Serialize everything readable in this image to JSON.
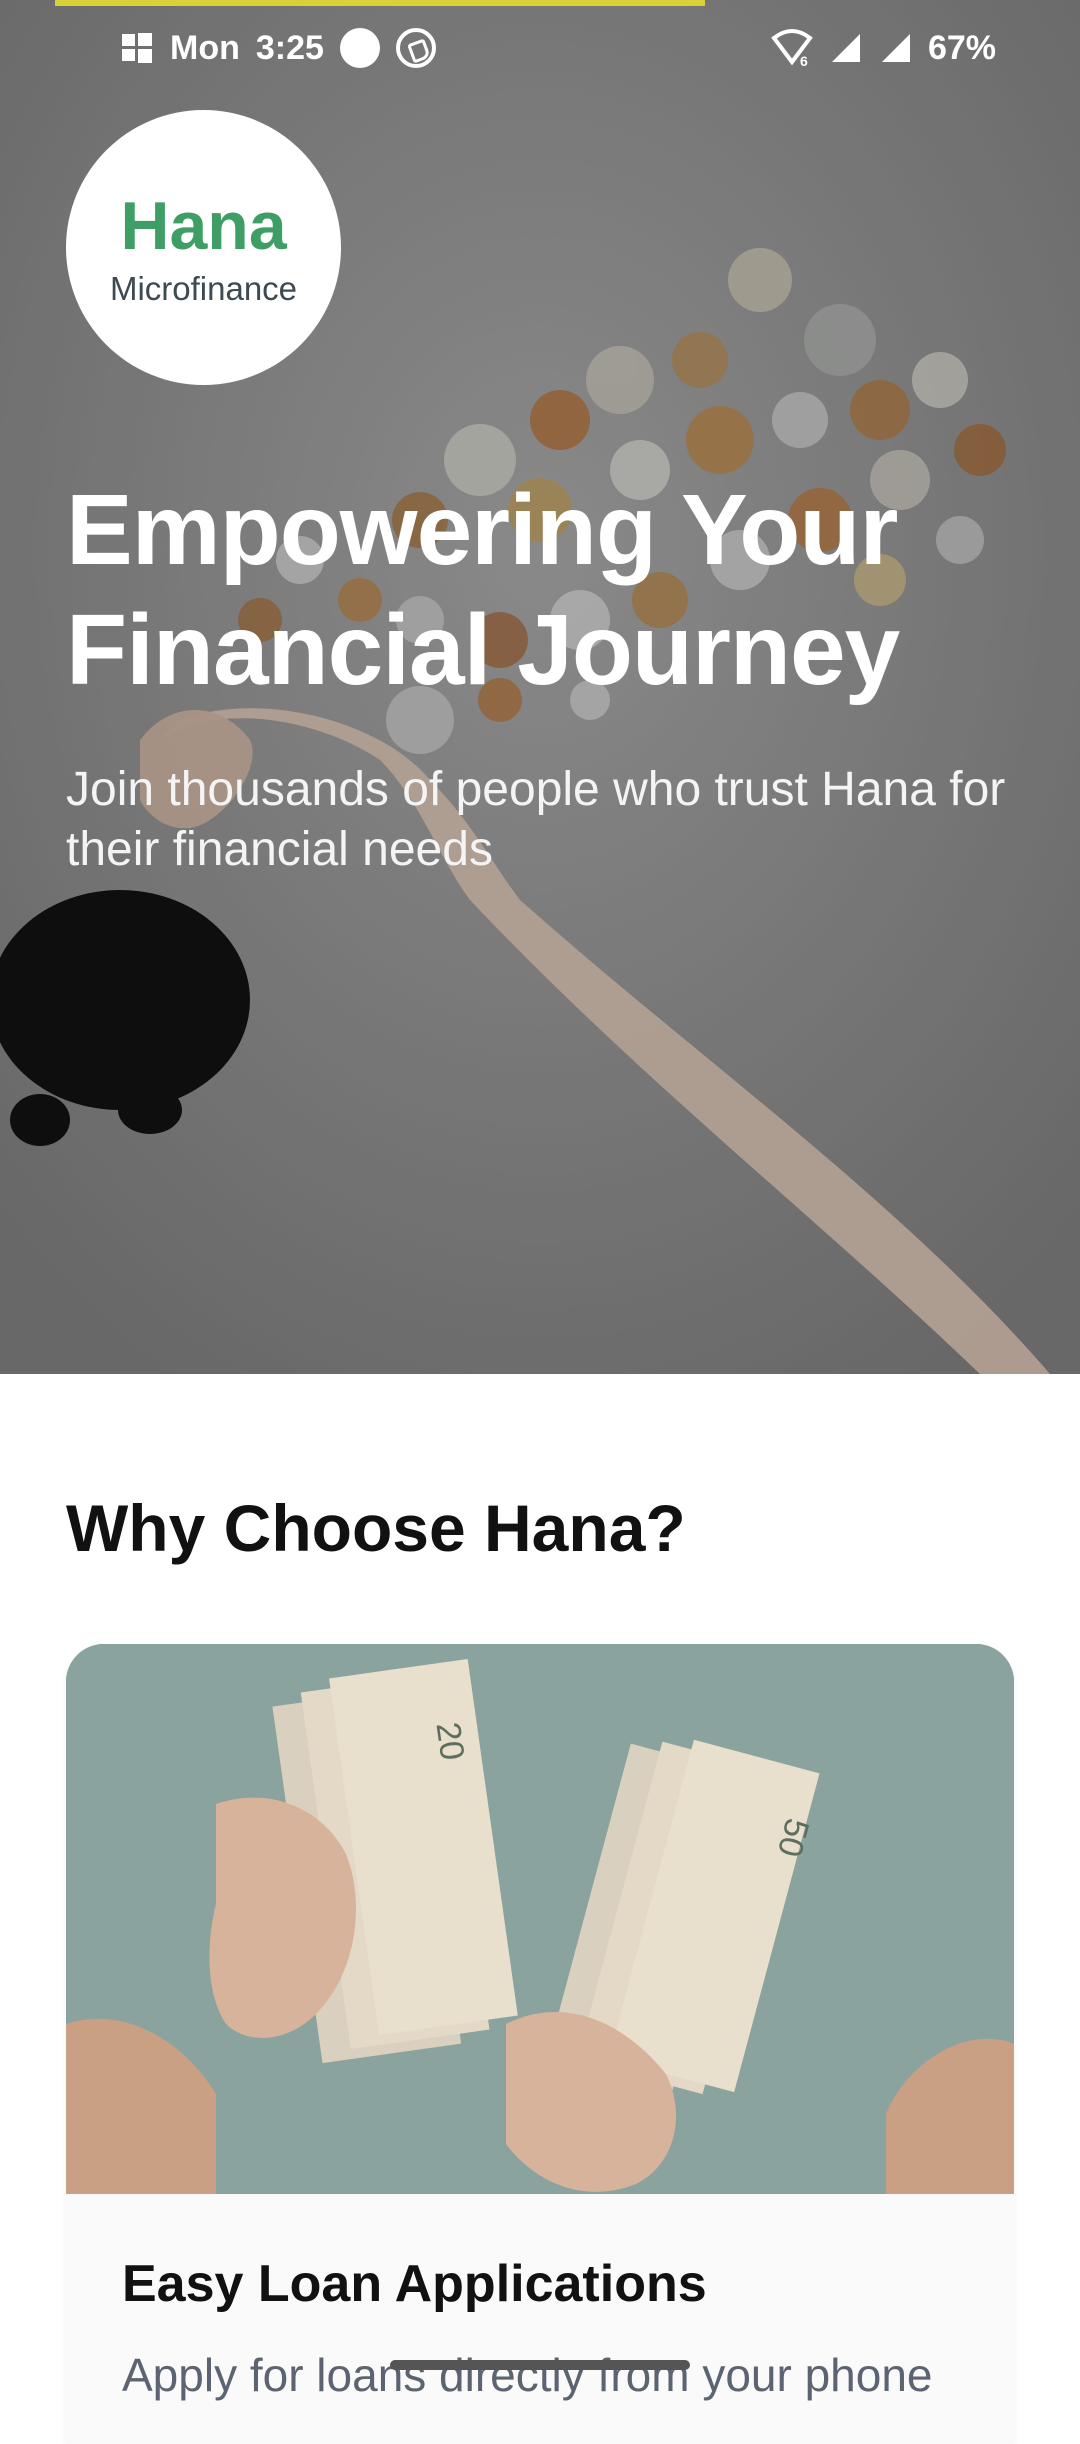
{
  "status_bar": {
    "day": "Mon",
    "time": "3:25",
    "battery": "67%",
    "icons": [
      "windows-icon",
      "record-dot-icon",
      "viber-icon",
      "wifi-icon",
      "signal-icon",
      "signal-icon-2"
    ]
  },
  "brand": {
    "name": "Hana",
    "subtitle": "Microfinance",
    "accent_color": "#3e9e66"
  },
  "hero": {
    "title_line1": "Empowering Your",
    "title_line2": "Financial Journey",
    "subtitle": "Join thousands of people who trust Hana for their financial needs"
  },
  "section": {
    "title": "Why Choose Hana?"
  },
  "feature_card": {
    "title": "Easy Loan Applications",
    "description": "Apply for loans directly from your phone"
  }
}
